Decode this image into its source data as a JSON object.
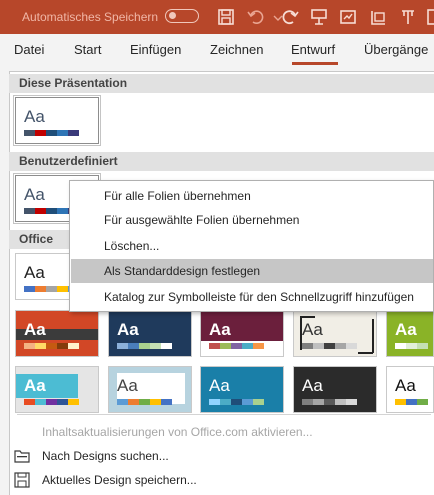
{
  "titlebar": {
    "autosave_label": "Automatisches Speichern",
    "accent_color": "#b7472a"
  },
  "ribbon_tabs": [
    "Datei",
    "Start",
    "Einfügen",
    "Zeichnen",
    "Entwurf",
    "Übergänge"
  ],
  "active_tab": "Entwurf",
  "sections": {
    "current": "Diese Präsentation",
    "custom": "Benutzerdefiniert",
    "office": "Office"
  },
  "thumb_text": "Aa",
  "context_menu": {
    "items": [
      "Für alle Folien übernehmen",
      "Für ausgewählte Folien übernehmen",
      "Löschen...",
      "Als Standarddesign festlegen",
      "Katalog zur Symbolleiste für den Schnellzugriff hinzufügen"
    ],
    "highlighted": "Als Standarddesign festlegen"
  },
  "commands": {
    "enable_updates": "Inhaltsaktualisierungen von Office.com aktivieren...",
    "browse": "Nach Designs suchen...",
    "save": "Aktuelles Design speichern..."
  },
  "icons": [
    "save-icon",
    "undo-icon",
    "redo-icon",
    "present-icon",
    "chart-icon",
    "format-icon",
    "pin-icon",
    "folder-icon",
    "floppy-icon"
  ]
}
